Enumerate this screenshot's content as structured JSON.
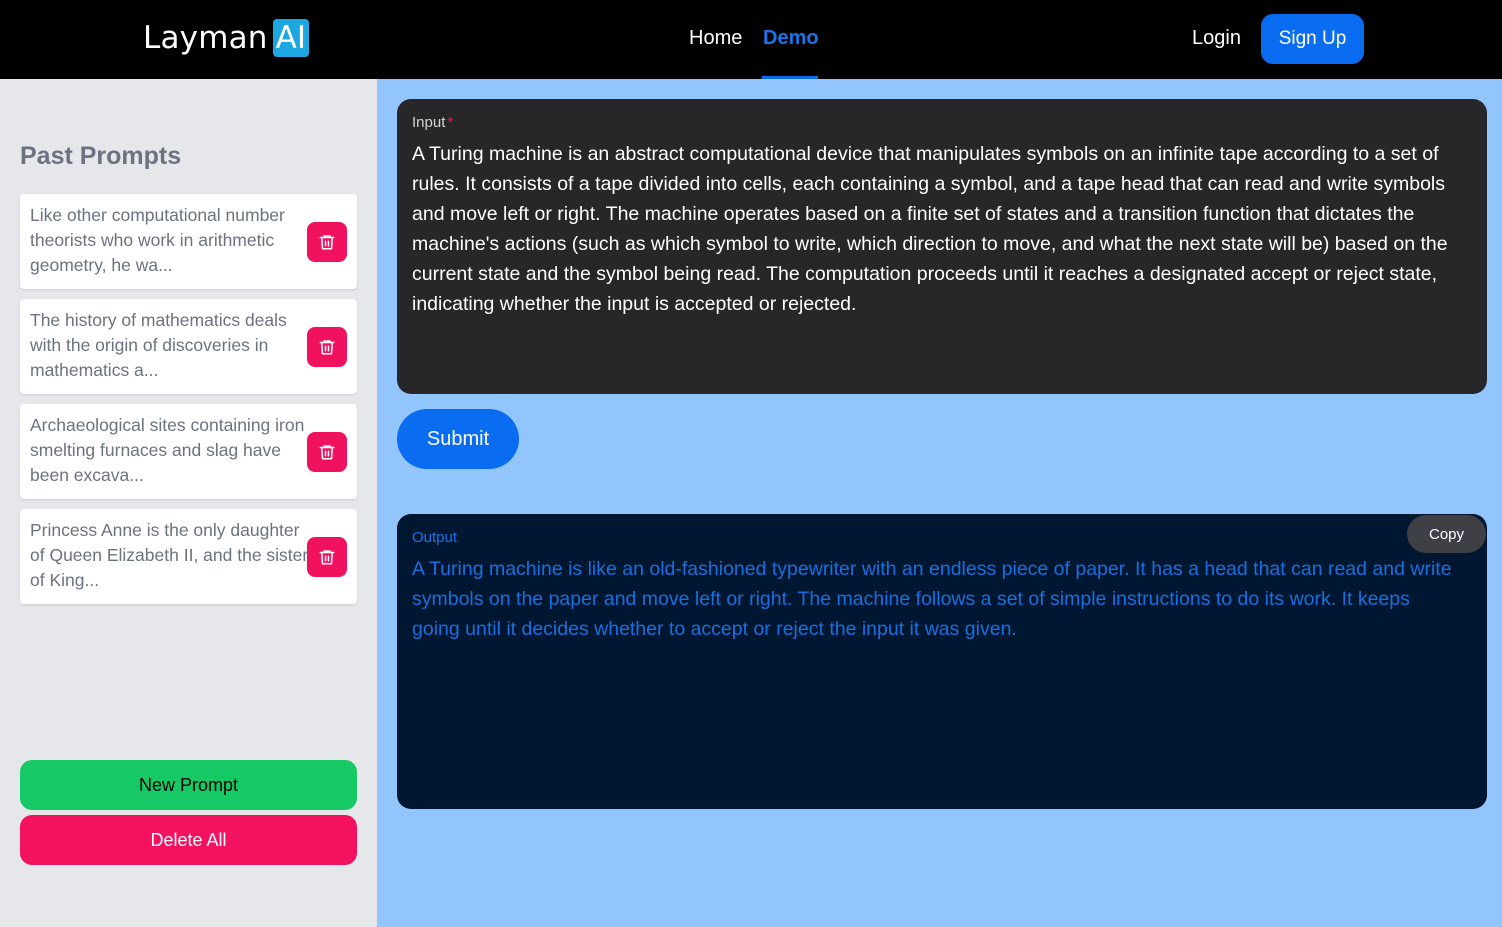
{
  "brand": {
    "name": "Layman",
    "badge": "AI"
  },
  "nav": {
    "home": "Home",
    "demo": "Demo",
    "login": "Login",
    "signup": "Sign Up"
  },
  "sidebar": {
    "title": "Past Prompts",
    "prompts": [
      {
        "text": "Like other computational number theorists who work in arithmetic geometry, he wa..."
      },
      {
        "text": "The history of mathematics deals with the origin of discoveries in mathematics a..."
      },
      {
        "text": "Archaeological sites containing iron smelting furnaces and slag have been excava..."
      },
      {
        "text": "Princess Anne is the only daughter of Queen Elizabeth II, and the sister of King..."
      }
    ],
    "new_prompt": "New Prompt",
    "delete_all": "Delete All",
    "trash_icon": "trash-icon"
  },
  "input": {
    "label": "Input",
    "required_marker": "*",
    "value": "A Turing machine is an abstract computational device that manipulates symbols on an infinite tape according to a set of rules. It consists of a tape divided into cells, each containing a symbol, and a tape head that can read and write symbols and move left or right. The machine operates based on a finite set of states and a transition function that dictates the machine's actions (such as which symbol to write, which direction to move, and what the next state will be) based on the current state and the symbol being read. The computation proceeds until it reaches a designated accept or reject state, indicating whether the input is accepted or rejected."
  },
  "submit": "Submit",
  "output": {
    "label": "Output",
    "copy": "Copy",
    "value": "A Turing machine is like an old-fashioned typewriter with an endless piece of paper. It has a head that can read and write symbols on the paper and move left or right. The machine follows a set of simple instructions to do its work. It keeps going until it decides whether to accept or reject the input it was given."
  },
  "colors": {
    "navbar": "#000000",
    "accent": "#0a6cf0",
    "sidebar": "#e5e7eb",
    "main_bg": "#93c5fd",
    "danger": "#f31260",
    "success": "#17c964"
  }
}
